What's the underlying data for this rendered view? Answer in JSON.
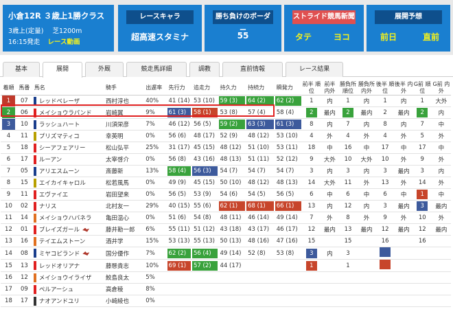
{
  "race": {
    "title": "小倉12R ３歳上1勝クラス",
    "condition": "3歳上(定量)",
    "distance": "芝1200m",
    "start": "16:15発走",
    "movie": "レース動画"
  },
  "panels": {
    "race_chara": {
      "title": "レースキャラ",
      "value": "超高速スタミナ"
    },
    "border": {
      "title": "勝ち負けのボーダー",
      "value": "55"
    },
    "stride": {
      "title": "ストライド競馬新聞",
      "v1": "タテ",
      "v2": "ヨコ"
    },
    "forecast": {
      "title": "展開予想",
      "v1": "前日",
      "v2": "直前"
    }
  },
  "tabs": [
    "基本",
    "展開",
    "外厩",
    "競走馬詳細",
    "調教",
    "直前情報",
    "レース結果"
  ],
  "columns": [
    "着順",
    "馬番",
    "馬名",
    "騎手",
    "出遅率",
    "先行力",
    "追走力",
    "持久力",
    "持続力",
    "瞬発力",
    "前半\n順位",
    "前半\n内外",
    "勝負所\n順位",
    "勝負所\n内外",
    "後半\n順位",
    "後半\n内外",
    "G前\n順位",
    "G前\n内外"
  ],
  "colors": {
    "accent": "#1a7fd0",
    "good": "#39a23c",
    "mid": "#3d5a9c",
    "bad": "#c7452b",
    "highlight": "#e02020"
  },
  "rows": [
    {
      "rank": "1",
      "num": "07",
      "name": "レッドベレーザ",
      "jockey": "西村淳也",
      "late": "40%",
      "sen": "41 (14)",
      "tsui": "53 (10)",
      "ji": "59 (3)",
      "jizoku": "64 (2)",
      "shun": "62 (2)",
      "z1": "1",
      "z2": "内",
      "s1": "1",
      "s2": "内",
      "k1": "1",
      "k2": "内",
      "g1": "1",
      "g2": "大外"
    },
    {
      "rank": "2",
      "num": "06",
      "name": "メイショウラパンド",
      "jockey": "岩崎翼",
      "late": "9%",
      "sen": "61 (3)",
      "tsui": "58 (1)",
      "ji": "53 (8)",
      "jizoku": "57 (4)",
      "shun": "58 (4)",
      "z1": "2",
      "z2": "最内",
      "s1": "2",
      "s2": "最内",
      "k1": "2",
      "k2": "最内",
      "g1": "2",
      "g2": "内"
    },
    {
      "rank": "3",
      "num": "10",
      "name": "ラッシュハート",
      "jockey": "川須栄彦",
      "late": "7%",
      "sen": "46 (12)",
      "tsui": "56 (5)",
      "ji": "59 (2)",
      "jizoku": "63 (3)",
      "shun": "61 (3)",
      "z1": "8",
      "z2": "内",
      "s1": "7",
      "s2": "内",
      "k1": "8",
      "k2": "内",
      "g1": "7",
      "g2": "中"
    },
    {
      "rank": "4",
      "num": "11",
      "name": "プリズマティコ",
      "jockey": "幸英明",
      "late": "0%",
      "sen": "56 (6)",
      "tsui": "48 (17)",
      "ji": "52 (9)",
      "jizoku": "48 (12)",
      "shun": "53 (10)",
      "z1": "4",
      "z2": "外",
      "s1": "4",
      "s2": "外",
      "k1": "4",
      "k2": "外",
      "g1": "5",
      "g2": "外"
    },
    {
      "rank": "5",
      "num": "18",
      "name": "シーアフェアリー",
      "jockey": "松山弘平",
      "late": "25%",
      "sen": "31 (17)",
      "tsui": "45 (15)",
      "ji": "48 (12)",
      "jizoku": "51 (10)",
      "shun": "53 (11)",
      "z1": "18",
      "z2": "中",
      "s1": "16",
      "s2": "中",
      "k1": "17",
      "k2": "中",
      "g1": "17",
      "g2": "中"
    },
    {
      "rank": "6",
      "num": "17",
      "name": "ルーアン",
      "jockey": "太宰啓介",
      "late": "0%",
      "sen": "56 (8)",
      "tsui": "43 (16)",
      "ji": "48 (13)",
      "jizoku": "51 (11)",
      "shun": "52 (12)",
      "z1": "9",
      "z2": "大外",
      "s1": "10",
      "s2": "大外",
      "k1": "10",
      "k2": "外",
      "g1": "9",
      "g2": "外"
    },
    {
      "rank": "7",
      "num": "05",
      "name": "アリエスムーン",
      "jockey": "斎藤新",
      "late": "13%",
      "sen": "58 (4)",
      "tsui": "56 (3)",
      "ji": "54 (7)",
      "jizoku": "54 (7)",
      "shun": "54 (7)",
      "z1": "3",
      "z2": "内",
      "s1": "3",
      "s2": "内",
      "k1": "3",
      "k2": "最内",
      "g1": "3",
      "g2": "内"
    },
    {
      "rank": "8",
      "num": "15",
      "name": "エイカイキャロル",
      "jockey": "松若風馬",
      "late": "0%",
      "sen": "49 (9)",
      "tsui": "45 (15)",
      "ji": "50 (10)",
      "jizoku": "48 (12)",
      "shun": "48 (13)",
      "z1": "14",
      "z2": "大外",
      "s1": "11",
      "s2": "外",
      "k1": "13",
      "k2": "外",
      "g1": "14",
      "g2": "外"
    },
    {
      "rank": "9",
      "num": "11",
      "name": "エヴァイエ",
      "jockey": "岩田望来",
      "late": "0%",
      "sen": "56 (5)",
      "tsui": "53 (9)",
      "ji": "54 (6)",
      "jizoku": "54 (5)",
      "shun": "56 (5)",
      "z1": "6",
      "z2": "中",
      "s1": "6",
      "s2": "中",
      "k1": "6",
      "k2": "中",
      "g1": "1",
      "g2": "中"
    },
    {
      "rank": "10",
      "num": "02",
      "name": "ナリス",
      "jockey": "北村友一",
      "late": "29%",
      "sen": "40 (15)",
      "tsui": "55 (6)",
      "ji": "62 (1)",
      "jizoku": "68 (1)",
      "shun": "66 (1)",
      "z1": "13",
      "z2": "内",
      "s1": "12",
      "s2": "内",
      "k1": "3",
      "k2": "最内",
      "g1": "3",
      "g2": "最内"
    },
    {
      "rank": "11",
      "num": "14",
      "name": "メイショウハバネラ",
      "jockey": "亀田温心",
      "late": "0%",
      "sen": "51 (6)",
      "tsui": "54 (8)",
      "ji": "48 (11)",
      "jizoku": "46 (14)",
      "shun": "49 (14)",
      "z1": "7",
      "z2": "外",
      "s1": "8",
      "s2": "外",
      "k1": "9",
      "k2": "外",
      "g1": "10",
      "g2": "外"
    },
    {
      "rank": "12",
      "num": "01",
      "name": "ブレイズガール",
      "jockey": "藤井勘一郎",
      "late": "6%",
      "sen": "55 (11)",
      "tsui": "51 (12)",
      "ji": "43 (18)",
      "jizoku": "43 (17)",
      "shun": "46 (17)",
      "z1": "12",
      "z2": "最内",
      "s1": "13",
      "s2": "最内",
      "k1": "12",
      "k2": "最内",
      "g1": "12",
      "g2": "最内"
    },
    {
      "rank": "13",
      "num": "16",
      "name": "テイエムストーン",
      "jockey": "酒井学",
      "late": "15%",
      "sen": "53 (13)",
      "tsui": "55 (13)",
      "ji": "50 (13)",
      "jizoku": "48 (16)",
      "shun": "47 (16)",
      "z1": "15",
      "z2": "",
      "s1": "15",
      "s2": "",
      "k1": "16",
      "k2": "",
      "g1": "16",
      "g2": ""
    },
    {
      "rank": "14",
      "num": "08",
      "name": "ミヤコピランド",
      "jockey": "国分優作",
      "late": "7%",
      "sen": "62 (2)",
      "tsui": "56 (4)",
      "ji": "49 (14)",
      "jizoku": "52 (8)",
      "shun": "53 (8)",
      "z1": "3",
      "z2": "内",
      "s1": "3",
      "s2": "",
      "k1": "",
      "k2": "",
      "g1": "",
      "g2": ""
    },
    {
      "rank": "15",
      "num": "13",
      "name": "レッドオリアナ",
      "jockey": "藤懸貴志",
      "late": "10%",
      "sen": "69 (1)",
      "tsui": "57 (2)",
      "ji": "44 (17)",
      "jizoku": "",
      "shun": "",
      "z1": "1",
      "z2": "",
      "s1": "1",
      "s2": "",
      "k1": "",
      "k2": "",
      "g1": "",
      "g2": ""
    },
    {
      "rank": "16",
      "num": "12",
      "name": "メイショウイライザ",
      "jockey": "鮫島良太",
      "late": "5%",
      "sen": "",
      "tsui": "",
      "ji": "",
      "jizoku": "",
      "shun": "",
      "z1": "",
      "z2": "",
      "s1": "",
      "s2": "",
      "k1": "",
      "k2": "",
      "g1": "",
      "g2": ""
    },
    {
      "rank": "17",
      "num": "09",
      "name": "ペルアーシュ",
      "jockey": "高倉稜",
      "late": "8%",
      "sen": "",
      "tsui": "",
      "ji": "",
      "jizoku": "",
      "shun": "",
      "z1": "",
      "z2": "",
      "s1": "",
      "s2": "",
      "k1": "",
      "k2": "",
      "g1": "",
      "g2": ""
    },
    {
      "rank": "18",
      "num": "17",
      "name": "ナオアンドユリ",
      "jockey": "小崎綾也",
      "late": "0%",
      "sen": "",
      "tsui": "",
      "ji": "",
      "jizoku": "",
      "shun": "",
      "z1": "",
      "z2": "",
      "s1": "",
      "s2": "",
      "k1": "",
      "k2": "",
      "g1": "",
      "g2": ""
    }
  ]
}
